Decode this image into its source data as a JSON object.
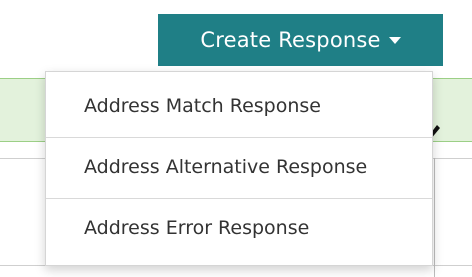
{
  "create_button": {
    "label": "Create Response",
    "icon": "caret-down-icon",
    "background": "#1f7f86",
    "text_color": "#ffffff"
  },
  "dropdown": {
    "items": [
      {
        "label": "Address Match Response"
      },
      {
        "label": "Address Alternative Response"
      },
      {
        "label": "Address Error Response"
      }
    ]
  },
  "background_table": {
    "highlight_color": "#e3f2dc",
    "edit_icon": "pencil-icon"
  }
}
